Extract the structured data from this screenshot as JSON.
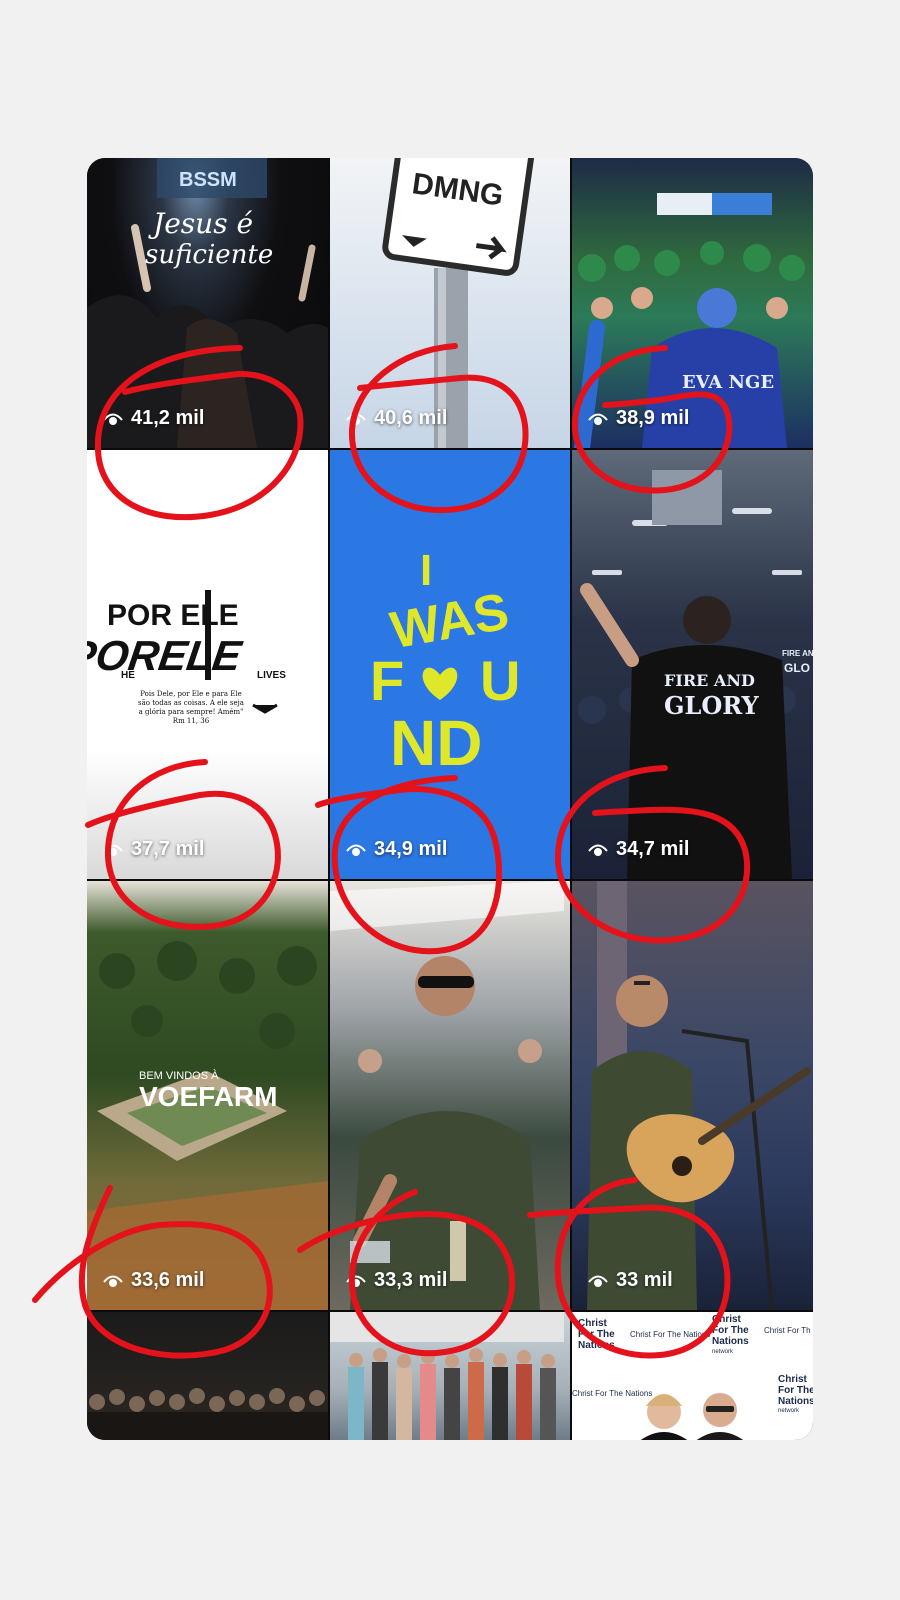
{
  "grid": {
    "tiles": [
      {
        "name": "tile-jesus-e-suficiente",
        "views": "41,2 mil",
        "caption_line1": "Jesus é",
        "caption_line2": "suficiente",
        "sign": "BSSM"
      },
      {
        "name": "tile-dmng-sign",
        "views": "40,6 mil",
        "sign": "DMNG"
      },
      {
        "name": "tile-crowd-green",
        "views": "38,9 mil",
        "shirt": "EVA NGE"
      },
      {
        "name": "tile-por-ele",
        "views": "37,7 mil",
        "title": "POR ELE",
        "graffiti": "PORELE",
        "left_tag": "HE",
        "right_tag": "LIVES",
        "verse": "Pois Dele, por Ele e para Ele são todas as coisas. A ele seja a glória para sempre! Amém\" Rm 11, 36"
      },
      {
        "name": "tile-i-was-found",
        "views": "34,9 mil",
        "l1": "I",
        "l2": "WAS",
        "l3": "F",
        "l4": "U",
        "l5": "ND"
      },
      {
        "name": "tile-fire-and-glory",
        "views": "34,7 mil",
        "shirt_l1": "FIRE AND",
        "shirt_l2": "GLORY",
        "side_l1": "FIRE AND",
        "side_l2": "GLO"
      },
      {
        "name": "tile-voefarm",
        "views": "33,6 mil",
        "small": "BEM VINDOS À",
        "big": "VOEFARM"
      },
      {
        "name": "tile-man-pouring",
        "views": "33,3 mil"
      },
      {
        "name": "tile-guitar-singer",
        "views": "33 mil"
      },
      {
        "name": "tile-crowd-dark"
      },
      {
        "name": "tile-group-photo"
      },
      {
        "name": "tile-christ-for-the-nations",
        "brand_l1": "Christ",
        "brand_l2": "For The",
        "brand_l3": "Nations",
        "brand_small": "network",
        "brand_inline": "Christ For The Nations",
        "brand_cut": "Christ For Th"
      }
    ]
  },
  "annotation_color": "#e4121a",
  "icons": {
    "views": "eye-icon"
  }
}
